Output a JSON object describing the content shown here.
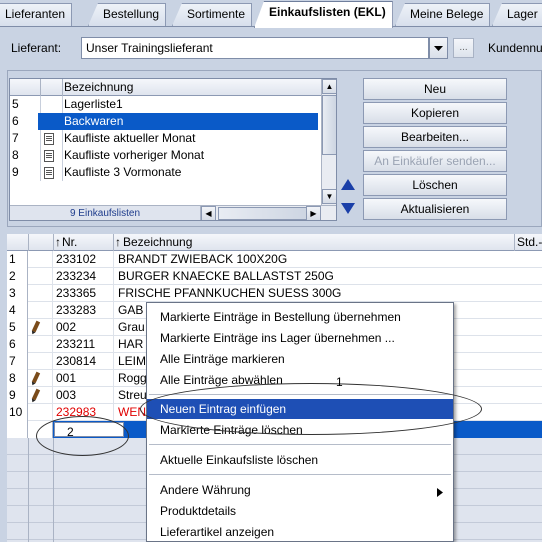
{
  "tabs": [
    "Lieferanten",
    "Bestellung",
    "Sortimente",
    "Einkaufslisten (EKL)",
    "Meine Belege",
    "Lager"
  ],
  "active_tab": "Einkaufslisten (EKL)",
  "supplier": {
    "label": "Lieferant:",
    "value": "Unser Trainingslieferant",
    "dots_button": "...",
    "customer_label": "Kundennu"
  },
  "lists": {
    "header": "Bezeichnung",
    "rows": [
      {
        "num": "5",
        "name": "Lagerliste1",
        "icon": "",
        "selected": false
      },
      {
        "num": "6",
        "name": "Backwaren",
        "icon": "",
        "selected": true
      },
      {
        "num": "7",
        "name": "Kaufliste aktueller Monat",
        "icon": "document-icon",
        "selected": false
      },
      {
        "num": "8",
        "name": "Kaufliste vorheriger Monat",
        "icon": "document-icon",
        "selected": false
      },
      {
        "num": "9",
        "name": "Kaufliste 3 Vormonate",
        "icon": "document-icon",
        "selected": false
      }
    ],
    "footer": "9 Einkaufslisten"
  },
  "buttons": {
    "neu": "Neu",
    "kopieren": "Kopieren",
    "bearbeiten": "Bearbeiten...",
    "senden": "An Einkäufer senden...",
    "loeschen": "Löschen",
    "aktualisieren": "Aktualisieren"
  },
  "grid": {
    "col_nr": "Nr.",
    "col_bez": "Bezeichnung",
    "col_std": "Std.-",
    "rows": [
      {
        "num": "1",
        "nr": "233102",
        "bez": "BRANDT ZWIEBACK 100X20G",
        "pencil": false,
        "red": false
      },
      {
        "num": "2",
        "nr": "233234",
        "bez": "BURGER KNAECKE BALLASTST 250G",
        "pencil": false,
        "red": false
      },
      {
        "num": "3",
        "nr": "233365",
        "bez": "FRISCHE PFANNKUCHEN SUESS 300G",
        "pencil": false,
        "red": false
      },
      {
        "num": "4",
        "nr": "233283",
        "bez": "GAB",
        "pencil": false,
        "red": false
      },
      {
        "num": "5",
        "nr": "002",
        "bez": "Grau",
        "pencil": true,
        "red": false
      },
      {
        "num": "6",
        "nr": "233211",
        "bez": "HAR",
        "pencil": false,
        "red": false
      },
      {
        "num": "7",
        "nr": "230814",
        "bez": "LEIM",
        "pencil": false,
        "red": false
      },
      {
        "num": "8",
        "nr": "001",
        "bez": "Rogg",
        "pencil": true,
        "red": false
      },
      {
        "num": "9",
        "nr": "003",
        "bez": "Streu",
        "pencil": true,
        "red": false
      },
      {
        "num": "10",
        "nr": "232983",
        "bez": "WEN",
        "pencil": false,
        "red": true
      }
    ]
  },
  "context_menu": {
    "items": [
      "Markierte Einträge in Bestellung übernehmen",
      "Markierte Einträge ins Lager übernehmen ...",
      "Alle Einträge markieren",
      "Alle Einträge abwählen",
      "Neuen Eintrag einfügen",
      "Markierte Einträge löschen",
      "Aktuelle Einkaufsliste löschen",
      "Andere Währung",
      "Produktdetails",
      "Lieferartikel anzeigen"
    ],
    "highlighted": "Neuen Eintrag einfügen"
  },
  "annotations": [
    "1",
    "2"
  ]
}
